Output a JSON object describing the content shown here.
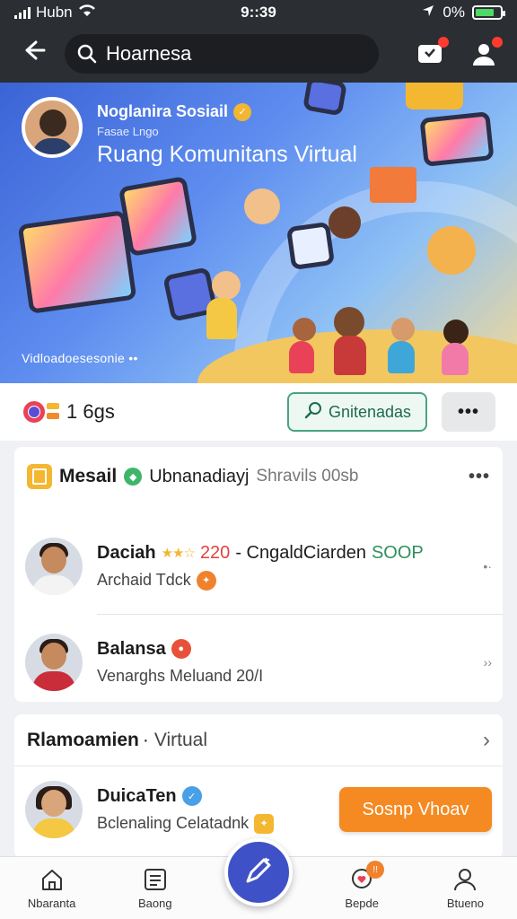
{
  "status_bar": {
    "carrier": "Hubn",
    "time": "9::39",
    "battery": "0%"
  },
  "top_nav": {
    "search_value": "Hoarnesa"
  },
  "banner": {
    "profile_name": "Noglanira Sosiail",
    "profile_sub": "Fasae Lngo",
    "profile_title": "Ruang Komunitans Virtual",
    "caption": "Vidloadoesesonie ••"
  },
  "action_row": {
    "count": "1 6gs",
    "follow_label": "Gnitenadas",
    "more_label": "•••"
  },
  "card1": {
    "title": "Mesail",
    "subtitle": "Ubnanadiayj",
    "subtitle2": "Shravils 00sb",
    "more": "•••",
    "items": [
      {
        "name": "Daciah",
        "stars": "★★☆",
        "number": "220",
        "line1_rest": "- CngaldCiarden",
        "tag": "SOOP",
        "line2": "Archaid Tdck"
      },
      {
        "name": "Balansa",
        "stars": "",
        "number": "",
        "line1_rest": "",
        "tag": "",
        "line2": "Venarghs Meluand 20/I"
      }
    ]
  },
  "card2": {
    "title": "Rlamoamien",
    "title2": "Virtual",
    "item": {
      "name": "DuicaTen",
      "line2": "Bclenaling Celatadnk",
      "button": "Sosnp Vhoav"
    }
  },
  "bottom_nav": {
    "items": [
      {
        "label": "Nbaranta"
      },
      {
        "label": "Baong"
      },
      {
        "label": "Bepde"
      },
      {
        "label": "Btueno"
      }
    ]
  },
  "colors": {
    "accent": "#3f51c7",
    "action_orange": "#f58a22",
    "follow_green": "#4aa382",
    "nav_dark": "#2b2e33"
  },
  "icons": [
    "back-arrow-icon",
    "search-icon",
    "chat-icon",
    "profile-add-icon",
    "home-icon",
    "list-icon",
    "edit-icon",
    "heart-icon",
    "user-icon"
  ]
}
